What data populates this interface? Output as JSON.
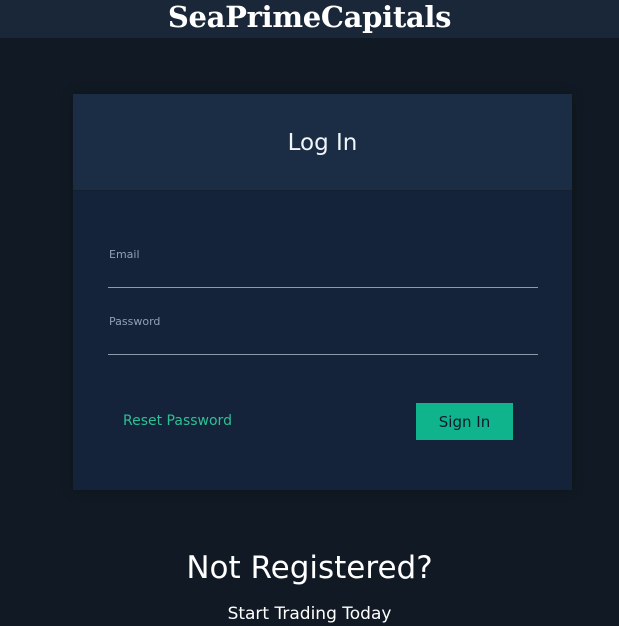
{
  "header": {
    "brand": "SeaPrimeCapitals"
  },
  "login": {
    "title": "Log In",
    "email_label": "Email",
    "email_value": "",
    "password_label": "Password",
    "password_value": "",
    "reset_label": "Reset Password",
    "signin_label": "Sign In"
  },
  "register": {
    "heading": "Not Registered?",
    "subheading": "Start Trading Today"
  },
  "colors": {
    "background": "#111a24",
    "topbar": "#1a2739",
    "card": "#15233a",
    "card_header": "#1a2d44",
    "accent": "#0fb48c",
    "link": "#2fbf94"
  }
}
